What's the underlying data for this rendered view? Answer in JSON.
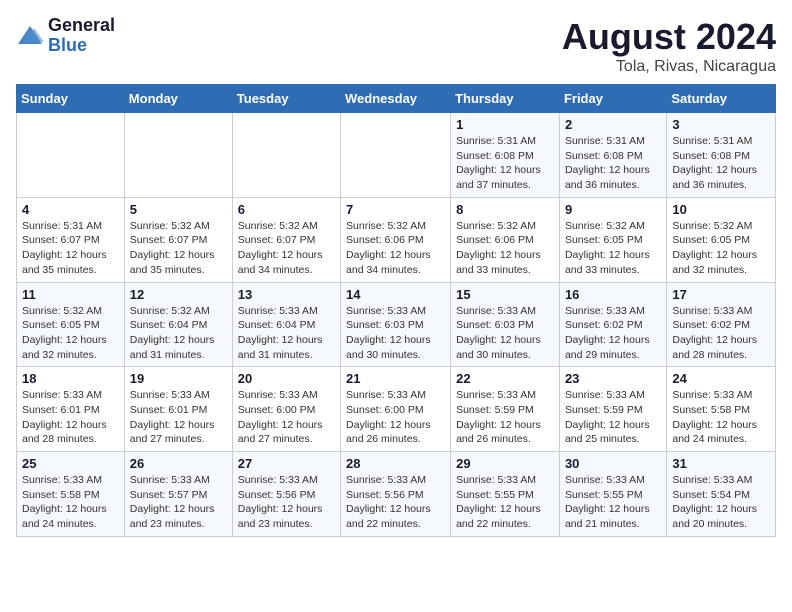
{
  "logo": {
    "text_general": "General",
    "text_blue": "Blue"
  },
  "header": {
    "month_year": "August 2024",
    "location": "Tola, Rivas, Nicaragua"
  },
  "weekdays": [
    "Sunday",
    "Monday",
    "Tuesday",
    "Wednesday",
    "Thursday",
    "Friday",
    "Saturday"
  ],
  "weeks": [
    [
      {
        "day": "",
        "info": ""
      },
      {
        "day": "",
        "info": ""
      },
      {
        "day": "",
        "info": ""
      },
      {
        "day": "",
        "info": ""
      },
      {
        "day": "1",
        "info": "Sunrise: 5:31 AM\nSunset: 6:08 PM\nDaylight: 12 hours\nand 37 minutes."
      },
      {
        "day": "2",
        "info": "Sunrise: 5:31 AM\nSunset: 6:08 PM\nDaylight: 12 hours\nand 36 minutes."
      },
      {
        "day": "3",
        "info": "Sunrise: 5:31 AM\nSunset: 6:08 PM\nDaylight: 12 hours\nand 36 minutes."
      }
    ],
    [
      {
        "day": "4",
        "info": "Sunrise: 5:31 AM\nSunset: 6:07 PM\nDaylight: 12 hours\nand 35 minutes."
      },
      {
        "day": "5",
        "info": "Sunrise: 5:32 AM\nSunset: 6:07 PM\nDaylight: 12 hours\nand 35 minutes."
      },
      {
        "day": "6",
        "info": "Sunrise: 5:32 AM\nSunset: 6:07 PM\nDaylight: 12 hours\nand 34 minutes."
      },
      {
        "day": "7",
        "info": "Sunrise: 5:32 AM\nSunset: 6:06 PM\nDaylight: 12 hours\nand 34 minutes."
      },
      {
        "day": "8",
        "info": "Sunrise: 5:32 AM\nSunset: 6:06 PM\nDaylight: 12 hours\nand 33 minutes."
      },
      {
        "day": "9",
        "info": "Sunrise: 5:32 AM\nSunset: 6:05 PM\nDaylight: 12 hours\nand 33 minutes."
      },
      {
        "day": "10",
        "info": "Sunrise: 5:32 AM\nSunset: 6:05 PM\nDaylight: 12 hours\nand 32 minutes."
      }
    ],
    [
      {
        "day": "11",
        "info": "Sunrise: 5:32 AM\nSunset: 6:05 PM\nDaylight: 12 hours\nand 32 minutes."
      },
      {
        "day": "12",
        "info": "Sunrise: 5:32 AM\nSunset: 6:04 PM\nDaylight: 12 hours\nand 31 minutes."
      },
      {
        "day": "13",
        "info": "Sunrise: 5:33 AM\nSunset: 6:04 PM\nDaylight: 12 hours\nand 31 minutes."
      },
      {
        "day": "14",
        "info": "Sunrise: 5:33 AM\nSunset: 6:03 PM\nDaylight: 12 hours\nand 30 minutes."
      },
      {
        "day": "15",
        "info": "Sunrise: 5:33 AM\nSunset: 6:03 PM\nDaylight: 12 hours\nand 30 minutes."
      },
      {
        "day": "16",
        "info": "Sunrise: 5:33 AM\nSunset: 6:02 PM\nDaylight: 12 hours\nand 29 minutes."
      },
      {
        "day": "17",
        "info": "Sunrise: 5:33 AM\nSunset: 6:02 PM\nDaylight: 12 hours\nand 28 minutes."
      }
    ],
    [
      {
        "day": "18",
        "info": "Sunrise: 5:33 AM\nSunset: 6:01 PM\nDaylight: 12 hours\nand 28 minutes."
      },
      {
        "day": "19",
        "info": "Sunrise: 5:33 AM\nSunset: 6:01 PM\nDaylight: 12 hours\nand 27 minutes."
      },
      {
        "day": "20",
        "info": "Sunrise: 5:33 AM\nSunset: 6:00 PM\nDaylight: 12 hours\nand 27 minutes."
      },
      {
        "day": "21",
        "info": "Sunrise: 5:33 AM\nSunset: 6:00 PM\nDaylight: 12 hours\nand 26 minutes."
      },
      {
        "day": "22",
        "info": "Sunrise: 5:33 AM\nSunset: 5:59 PM\nDaylight: 12 hours\nand 26 minutes."
      },
      {
        "day": "23",
        "info": "Sunrise: 5:33 AM\nSunset: 5:59 PM\nDaylight: 12 hours\nand 25 minutes."
      },
      {
        "day": "24",
        "info": "Sunrise: 5:33 AM\nSunset: 5:58 PM\nDaylight: 12 hours\nand 24 minutes."
      }
    ],
    [
      {
        "day": "25",
        "info": "Sunrise: 5:33 AM\nSunset: 5:58 PM\nDaylight: 12 hours\nand 24 minutes."
      },
      {
        "day": "26",
        "info": "Sunrise: 5:33 AM\nSunset: 5:57 PM\nDaylight: 12 hours\nand 23 minutes."
      },
      {
        "day": "27",
        "info": "Sunrise: 5:33 AM\nSunset: 5:56 PM\nDaylight: 12 hours\nand 23 minutes."
      },
      {
        "day": "28",
        "info": "Sunrise: 5:33 AM\nSunset: 5:56 PM\nDaylight: 12 hours\nand 22 minutes."
      },
      {
        "day": "29",
        "info": "Sunrise: 5:33 AM\nSunset: 5:55 PM\nDaylight: 12 hours\nand 22 minutes."
      },
      {
        "day": "30",
        "info": "Sunrise: 5:33 AM\nSunset: 5:55 PM\nDaylight: 12 hours\nand 21 minutes."
      },
      {
        "day": "31",
        "info": "Sunrise: 5:33 AM\nSunset: 5:54 PM\nDaylight: 12 hours\nand 20 minutes."
      }
    ]
  ]
}
